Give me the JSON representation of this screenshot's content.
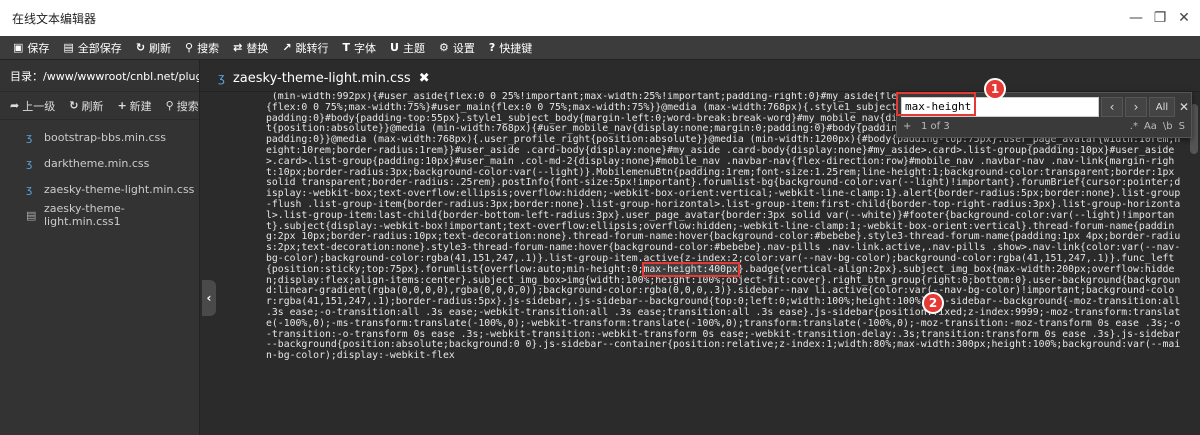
{
  "window": {
    "title": "在线文本编辑器"
  },
  "toolbar": {
    "items": [
      {
        "icon": "save-icon",
        "glyph": "▣",
        "label": "保存"
      },
      {
        "icon": "save-all-icon",
        "glyph": "▤",
        "label": "全部保存"
      },
      {
        "icon": "refresh-icon",
        "glyph": "↻",
        "label": "刷新"
      },
      {
        "icon": "search-icon",
        "glyph": "⚲",
        "label": "搜索"
      },
      {
        "icon": "replace-icon",
        "glyph": "⇄",
        "label": "替换"
      },
      {
        "icon": "goto-line-icon",
        "glyph": "↗",
        "label": "跳转行"
      },
      {
        "icon": "font-icon",
        "glyph": "T",
        "label": "字体"
      },
      {
        "icon": "theme-icon",
        "glyph": "U",
        "label": "主题"
      },
      {
        "icon": "settings-icon",
        "glyph": "⚙",
        "label": "设置"
      },
      {
        "icon": "help-icon",
        "glyph": "?",
        "label": "快捷键"
      }
    ]
  },
  "sidebar": {
    "path": "目录：/www/wwwroot/cnbl.net/plugin...",
    "actions": [
      {
        "icon": "up-icon",
        "glyph": "➦",
        "label": "上一级"
      },
      {
        "icon": "refresh-icon",
        "glyph": "↻",
        "label": "刷新"
      },
      {
        "icon": "new-icon",
        "glyph": "+",
        "label": "新建"
      },
      {
        "icon": "search-icon",
        "glyph": "⚲",
        "label": "搜索"
      }
    ],
    "files": [
      {
        "name": "bootstrap-bbs.min.css",
        "type": "css"
      },
      {
        "name": "darktheme.min.css",
        "type": "css"
      },
      {
        "name": "zaesky-theme-light.min.css",
        "type": "css"
      },
      {
        "name": "zaesky-theme-light.min.css1",
        "type": "file"
      }
    ]
  },
  "tab": {
    "label": "zaesky-theme-light.min.css",
    "close": "✖"
  },
  "search": {
    "value": "max-height",
    "count": "1 of 3",
    "prev": "‹",
    "next": "›",
    "all": "All",
    "close": "✕",
    "plus": "+",
    "options": [
      ".*",
      "Aa",
      "\\b",
      "S"
    ]
  },
  "badges": [
    "1",
    "2"
  ],
  "colors": {
    "accent_red": "#e53935",
    "toolbar": "#3c3c3c",
    "editor_bg": "#2b2b2b"
  },
  "code": {
    "before": " (min-width:992px){#user_aside{flex:0 0 25%!important;max-width:25%!important;padding-right:0}#my_aside{flex:0 0 25%;max-width:25%;padding-right:0}#my_main{flex:0 0 75%;max-width:75%}#user_main{flex:0 0 75%;max-width:75%}}@media (max-width:768px){.style1_subject_body{:0}#user_mobile_nav{display:none;margin:0;padding:0}#body{padding-top:55px}.style1_subject_body{margin-left:0;word-break:break-word}#my_mobile_nav{display:none;margin:0;padding:0}.user_profile_right{position:absolute}}@media (min-width:768px){#user_mobile_nav{display:none;margin:0;padding:0}#body{padding-top:75px}#my_mobile_nav{display:none;margin:0;padding:0}}@media (max-width:768px){.user_profile_right{position:absolute}}@media (min-width:1200px){#body{padding-top:75px}.user_page_avatar{width:10rem;height:10rem;border-radius:1rem}}#user_aside .card-body{display:none}#my_aside .card-body{display:none}#my_aside>.card>.list-group{padding:10px}#user_aside>.card>.list-group{padding:10px}#user_main .col-md-2{display:none}#mobile_nav .navbar-nav{flex-direction:row}#mobile_nav .navbar-nav .nav-link{margin-right:10px;border-radius:3px;background-color:var(--light)}.MobilemenuBtn{padding:1rem;font-size:1.25rem;line-height:1;background-color:transparent;border:1px solid transparent;border-radius:.25rem}.postInfo{font-size:5px!important}.forumlist-bg{background-color:var(--light)!important}.forumBrief{cursor:pointer;display:-webkit-box;text-overflow:ellipsis;overflow:hidden;-webkit-box-orient:vertical;-webkit-line-clamp:1}.alert{border-radius:5px;border:none}.list-group-flush .list-group-item{border-radius:3px;border:none}.list-group-horizontal>.list-group-item:first-child{border-top-right-radius:3px}.list-group-horizontal>.list-group-item:last-child{border-bottom-left-radius:3px}.user_page_avatar{border:3px solid var(--white)}#footer{background-color:var(--light)!important}.subject{display:-webkit-box!important;text-overflow:ellipsis;overflow:hidden;-webkit-line-clamp:1;-webkit-box-orient:vertical}.thread-forum-name{padding:2px 10px;border-radius:10px;text-decoration:none}.thread-forum-name:hover{background-color:#bebebe}.style3-thread-forum-name{padding:1px 4px;border-radius:2px;text-decoration:none}.style3-thread-forum-name:hover{background-color:#bebebe}.nav-pills .nav-link.active,.nav-pills .show>.nav-link{color:var(--nav-bg-color);background-color:rgba(41,151,247,.1)}.list-group-item.active{z-index:2;color:var(--nav-bg-color);background-color:rgba(41,151,247,.1)}.func_left{position:sticky;top:75px}.forumlist{overflow:auto;min-height:0;",
    "match": "max-height:400px",
    "after": "}.badge{vertical-align:2px}.subject_img_box{max-width:200px;overflow:hidden;display:flex;align-items:center}.subject_img_box>img{width:100%;height:100%;object-fit:cover}.right_btn_group{right:0;bottom:0}.user-background{background:linear-gradient(rgba(0,0,0,0),rgba(0,0,0,0));background-color:rgba(0,0,0,.3)}.sidebar--nav li.active{color:var(--nav-bg-color)!important;background-color:rgba(41,151,247,.1);border-radius:5px}.js-sidebar,.js-sidebar--background{top:0;left:0;width:100%;height:100%}.js-sidebar--background{-moz-transition:all .3s ease;-o-transition:all .3s ease;-webkit-transition:all .3s ease;transition:all .3s ease}.js-sidebar{position:fixed;z-index:9999;-moz-transform:translate(-100%,0);-ms-transform:translate(-100%,0);-webkit-transform:translate(-100%,0);transform:translate(-100%,0);-moz-transition:-moz-transform 0s ease .3s;-o-transition:-o-transform 0s ease .3s;-webkit-transition:-webkit-transform 0s ease;-webkit-transition-delay:.3s;transition:transform 0s ease .3s}.js-sidebar--background{position:absolute;background:0 0}.js-sidebar--container{position:relative;z-index:1;width:80%;max-width:300px;height:100%;background:var(--main-bg-color);display:-webkit-flex"
  }
}
